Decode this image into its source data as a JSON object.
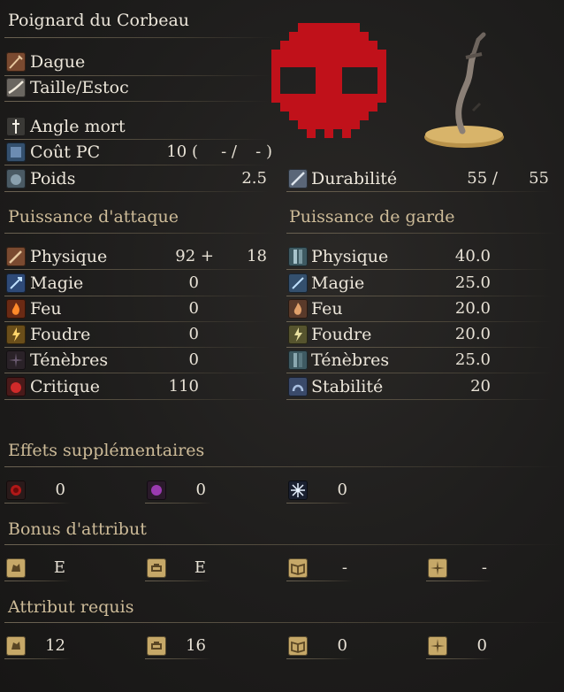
{
  "weapon": {
    "name": "Poignard du Corbeau",
    "type": "Dague",
    "attack_type": "Taille/Estoc",
    "skill": "Angle mort",
    "fp_cost_label": "Coût PC",
    "fp_cost_value": "10 (",
    "fp_cost_mid": "- /",
    "fp_cost_end": "- )",
    "weight_label": "Poids",
    "weight_value": "2.5",
    "durability_label": "Durabilité",
    "durability_current": "55 /",
    "durability_max": "55"
  },
  "attack_power": {
    "heading": "Puissance d'attaque",
    "rows": [
      {
        "label": "Physique",
        "value": "92 +",
        "bonus": "18",
        "icon": "sword-icon",
        "color": "#8a5a3a"
      },
      {
        "label": "Magie",
        "value": "0",
        "bonus": "",
        "icon": "magic-icon",
        "color": "#3a5a8a"
      },
      {
        "label": "Feu",
        "value": "0",
        "bonus": "",
        "icon": "fire-icon",
        "color": "#a84a20"
      },
      {
        "label": "Foudre",
        "value": "0",
        "bonus": "",
        "icon": "lightning-icon",
        "color": "#a8822a"
      },
      {
        "label": "Ténèbres",
        "value": "0",
        "bonus": "",
        "icon": "dark-icon",
        "color": "#3a2a3a"
      },
      {
        "label": "Critique",
        "value": "110",
        "bonus": "",
        "icon": "critical-icon",
        "color": "#8a2a2a"
      }
    ]
  },
  "guard": {
    "heading": "Puissance de garde",
    "rows": [
      {
        "label": "Physique",
        "value": "40.0",
        "icon": "shield-physical-icon"
      },
      {
        "label": "Magie",
        "value": "25.0",
        "icon": "shield-magic-icon"
      },
      {
        "label": "Feu",
        "value": "20.0",
        "icon": "shield-fire-icon"
      },
      {
        "label": "Foudre",
        "value": "20.0",
        "icon": "shield-lightning-icon"
      },
      {
        "label": "Ténèbres",
        "value": "25.0",
        "icon": "shield-dark-icon"
      },
      {
        "label": "Stabilité",
        "value": "20",
        "icon": "stability-icon"
      }
    ]
  },
  "effects": {
    "heading": "Effets supplémentaires",
    "items": [
      {
        "icon": "bleed-icon",
        "value": "0",
        "color": "#9a1a1a"
      },
      {
        "icon": "poison-icon",
        "value": "0",
        "color": "#8a3a9a"
      },
      {
        "icon": "frost-icon",
        "value": "0",
        "color": "#cfe4ff"
      }
    ]
  },
  "scaling": {
    "heading": "Bonus d'attribut",
    "items": [
      {
        "icon": "strength-icon",
        "value": "E"
      },
      {
        "icon": "dexterity-icon",
        "value": "E"
      },
      {
        "icon": "intelligence-icon",
        "value": "-"
      },
      {
        "icon": "faith-icon",
        "value": "-"
      }
    ]
  },
  "requirements": {
    "heading": "Attribut requis",
    "items": [
      {
        "icon": "strength-icon",
        "value": "12"
      },
      {
        "icon": "dexterity-icon",
        "value": "16"
      },
      {
        "icon": "intelligence-icon",
        "value": "0"
      },
      {
        "icon": "faith-icon",
        "value": "0"
      }
    ]
  },
  "colors": {
    "accent": "#cdbb98",
    "skull": "#c0111a"
  }
}
